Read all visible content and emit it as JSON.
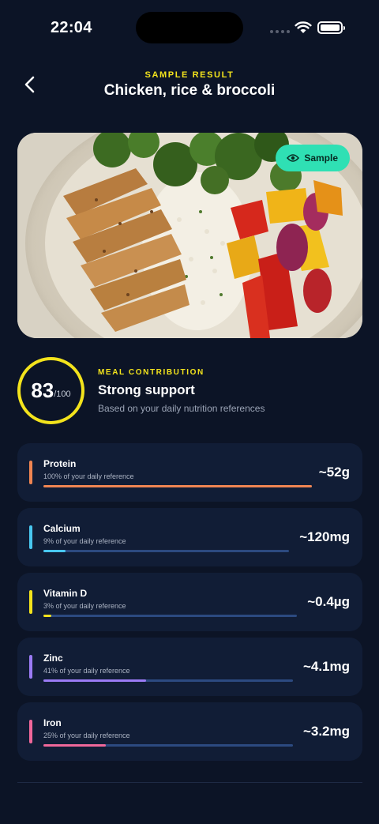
{
  "status": {
    "time": "22:04"
  },
  "header": {
    "kicker": "SAMPLE RESULT",
    "title": "Chicken, rice & broccoli"
  },
  "hero": {
    "chip_label": "Sample",
    "chip_icon": "eye-icon"
  },
  "score": {
    "value": "83",
    "max": "/100",
    "kicker": "MEAL CONTRIBUTION",
    "title": "Strong support",
    "subtitle": "Based on your daily nutrition references",
    "ring_color": "#f3e31c"
  },
  "nutrients": [
    {
      "name": "Protein",
      "sub": "100% of your daily reference",
      "value": "~52g",
      "percent": 100,
      "color": "#f08552"
    },
    {
      "name": "Calcium",
      "sub": "9% of your daily reference",
      "value": "~120mg",
      "percent": 9,
      "color": "#48c7f0"
    },
    {
      "name": "Vitamin D",
      "sub": "3% of your daily reference",
      "value": "~0.4µg",
      "percent": 3,
      "color": "#f3e31c"
    },
    {
      "name": "Zinc",
      "sub": "41% of your daily reference",
      "value": "~4.1mg",
      "percent": 41,
      "color": "#9b7bf5"
    },
    {
      "name": "Iron",
      "sub": "25% of your daily reference",
      "value": "~3.2mg",
      "percent": 25,
      "color": "#f0679a"
    }
  ],
  "colors": {
    "background": "#0c1426",
    "card": "#111d36",
    "accent": "#f3e31c",
    "chip": "#2fe0b4",
    "track": "#2c4a80"
  }
}
